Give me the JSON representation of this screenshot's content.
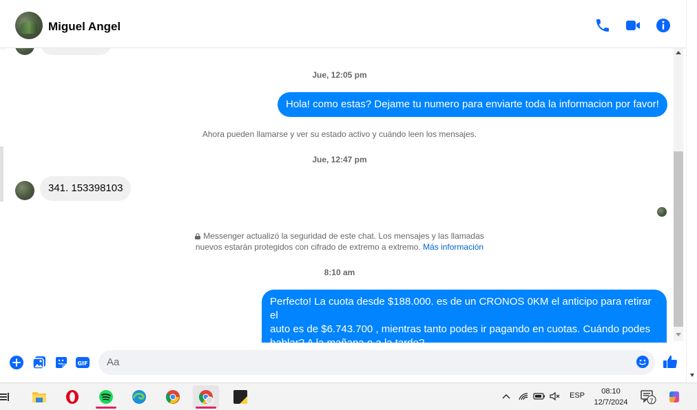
{
  "header": {
    "contact_name": "Miguel Angel"
  },
  "conversation": {
    "timestamp_1": "Jue, 12:05 pm",
    "outgoing_1": "Hola! como estas? Dejame tu numero para enviarte toda la informacion por favor!",
    "system_notice_1": "Ahora pueden llamarse y ver su estado activo y cuándo leen los mensajes.",
    "timestamp_2": "Jue, 12:47 pm",
    "incoming_1": "341. 153398103",
    "security_notice_line1": "Messenger actualizó la seguridad de este chat. Los mensajes y las llamadas",
    "security_notice_line2": "nuevos estarán protegidos con cifrado de extremo a extremo.",
    "security_link": "Más información",
    "timestamp_3": "8:10 am",
    "outgoing_2_line1": "Perfecto! La cuota desde $188.000. es de un CRONOS 0KM el anticipo para retirar el",
    "outgoing_2_line2": "auto es de $6.743.700 , mientras tanto podes ir pagando en cuotas. Cuándo podes",
    "outgoing_2_line3": "hablar? A la mañana o a la tarde?"
  },
  "composer": {
    "placeholder": "Aa"
  },
  "taskbar": {
    "language": "ESP",
    "time": "08:10",
    "date": "12/7/2024",
    "notification_count": "7"
  },
  "colors": {
    "accent": "#0084ff",
    "icon_blue": "#0866ff",
    "bubble_incoming": "#f0f0f0",
    "text_secondary": "#65676b"
  }
}
